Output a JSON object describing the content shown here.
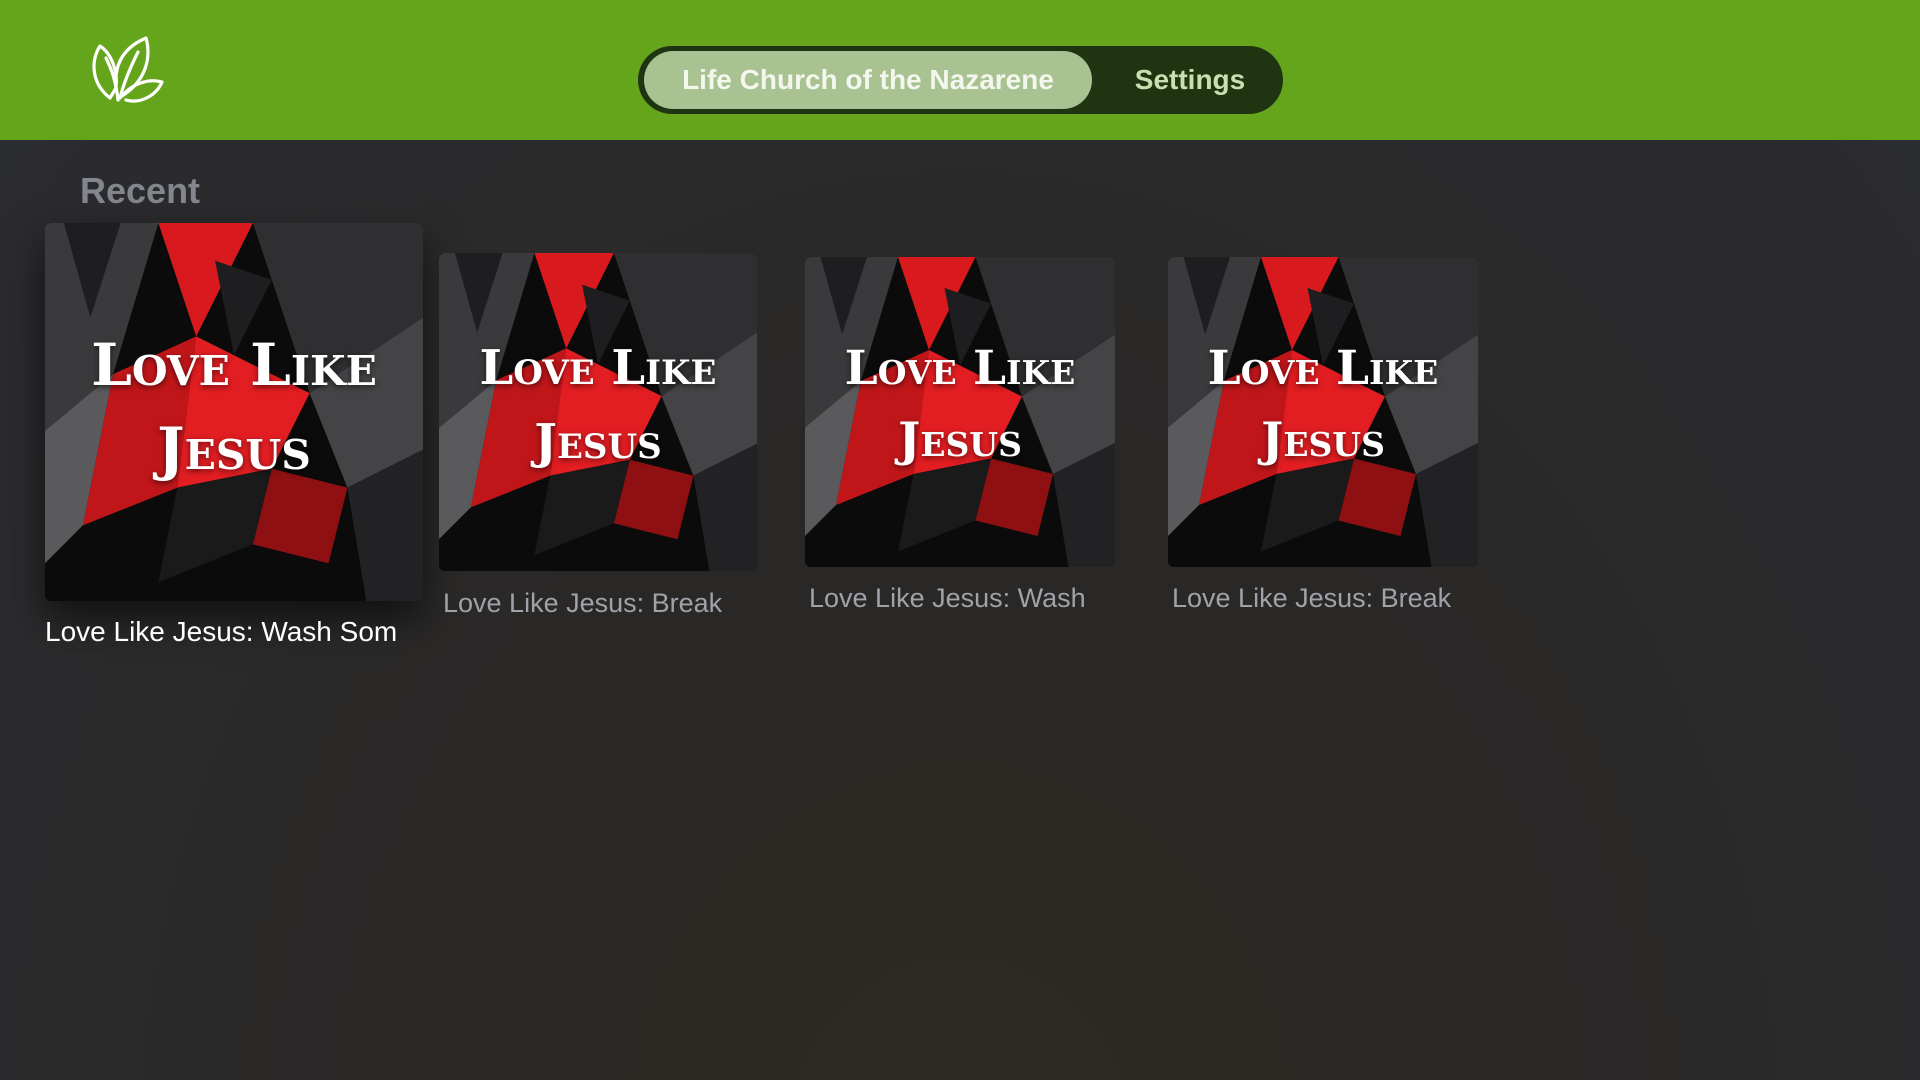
{
  "header": {
    "logo_icon": "leaf-logo-icon",
    "tabs": [
      {
        "label": "Life Church of the Nazarene",
        "selected": true
      },
      {
        "label": "Settings",
        "selected": false
      }
    ],
    "background_color": "#65a51c"
  },
  "recent": {
    "title": "Recent",
    "items": [
      {
        "label": "Love Like Jesus: Wash Som",
        "artwork_title_line1": "Love Like",
        "artwork_title_line2": "Jesus",
        "focused": true
      },
      {
        "label": "Love Like Jesus: Break",
        "artwork_title_line1": "Love Like",
        "artwork_title_line2": "Jesus",
        "focused": false
      },
      {
        "label": "Love Like Jesus: Wash",
        "artwork_title_line1": "Love Like",
        "artwork_title_line2": "Jesus",
        "focused": false
      },
      {
        "label": "Love Like Jesus: Break",
        "artwork_title_line1": "Love Like",
        "artwork_title_line2": "Jesus",
        "focused": false
      }
    ]
  },
  "colors": {
    "accent_green": "#65a51c",
    "artwork_red": "#d8191d",
    "artwork_dark": "#1a1a1a"
  }
}
